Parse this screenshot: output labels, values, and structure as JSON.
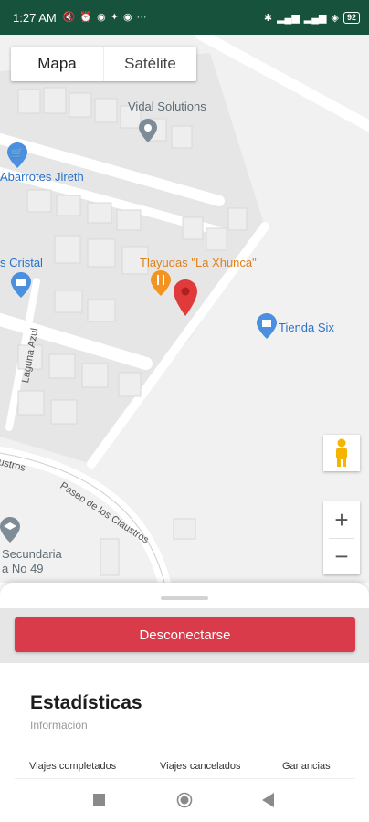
{
  "status_bar": {
    "time": "1:27 AM",
    "left_icons": [
      "mute-icon",
      "alarm-icon",
      "facebook-icon",
      "twitter-icon",
      "facebook-icon",
      "more-icon"
    ],
    "right_icons": [
      "bluetooth-icon",
      "signal-icon",
      "signal-icon",
      "wifi-icon"
    ],
    "battery": "92"
  },
  "map": {
    "map_type_options": [
      "Mapa",
      "Satélite"
    ],
    "selected_map_type": "Mapa",
    "pois": [
      {
        "label": "Vidal Solutions",
        "icon": "pin-icon",
        "color": "gray"
      },
      {
        "label": "Abarrotes Jireth",
        "icon": "shopping-cart-icon",
        "color": "blue"
      },
      {
        "label": "s Cristal",
        "icon": "shopping-bag-icon",
        "color": "blue"
      },
      {
        "label": "Tlayudas \"La Xhunca\"",
        "icon": "restaurant-icon",
        "color": "orange"
      },
      {
        "label": "Tienda Six",
        "icon": "shopping-bag-icon",
        "color": "blue"
      },
      {
        "label": "Secundaria",
        "icon": "school-icon",
        "color": "gray"
      },
      {
        "label": "a No 49",
        "icon": "",
        "color": "gray"
      }
    ],
    "road_labels": [
      "Laguna Azul",
      "ustros",
      "Paseo de los Claustros"
    ],
    "zoom_in": "+",
    "zoom_out": "−",
    "street_view_icon": "pegman-icon",
    "marker_icon": "location-marker-icon"
  },
  "sheet": {
    "disconnect_label": "Desconectarse",
    "stats_title": "Estadísticas",
    "stats_subtitle": "Información",
    "stat_labels": [
      "Viajes completados",
      "Viajes cancelados",
      "Ganancias"
    ]
  },
  "nav": {
    "recent_icon": "square-icon",
    "home_icon": "circle-icon",
    "back_icon": "triangle-back-icon"
  },
  "colors": {
    "status_bar": "#17523c",
    "accent_red": "#d93b4a",
    "poi_blue": "#2a72c9",
    "poi_orange": "#e0811c"
  }
}
